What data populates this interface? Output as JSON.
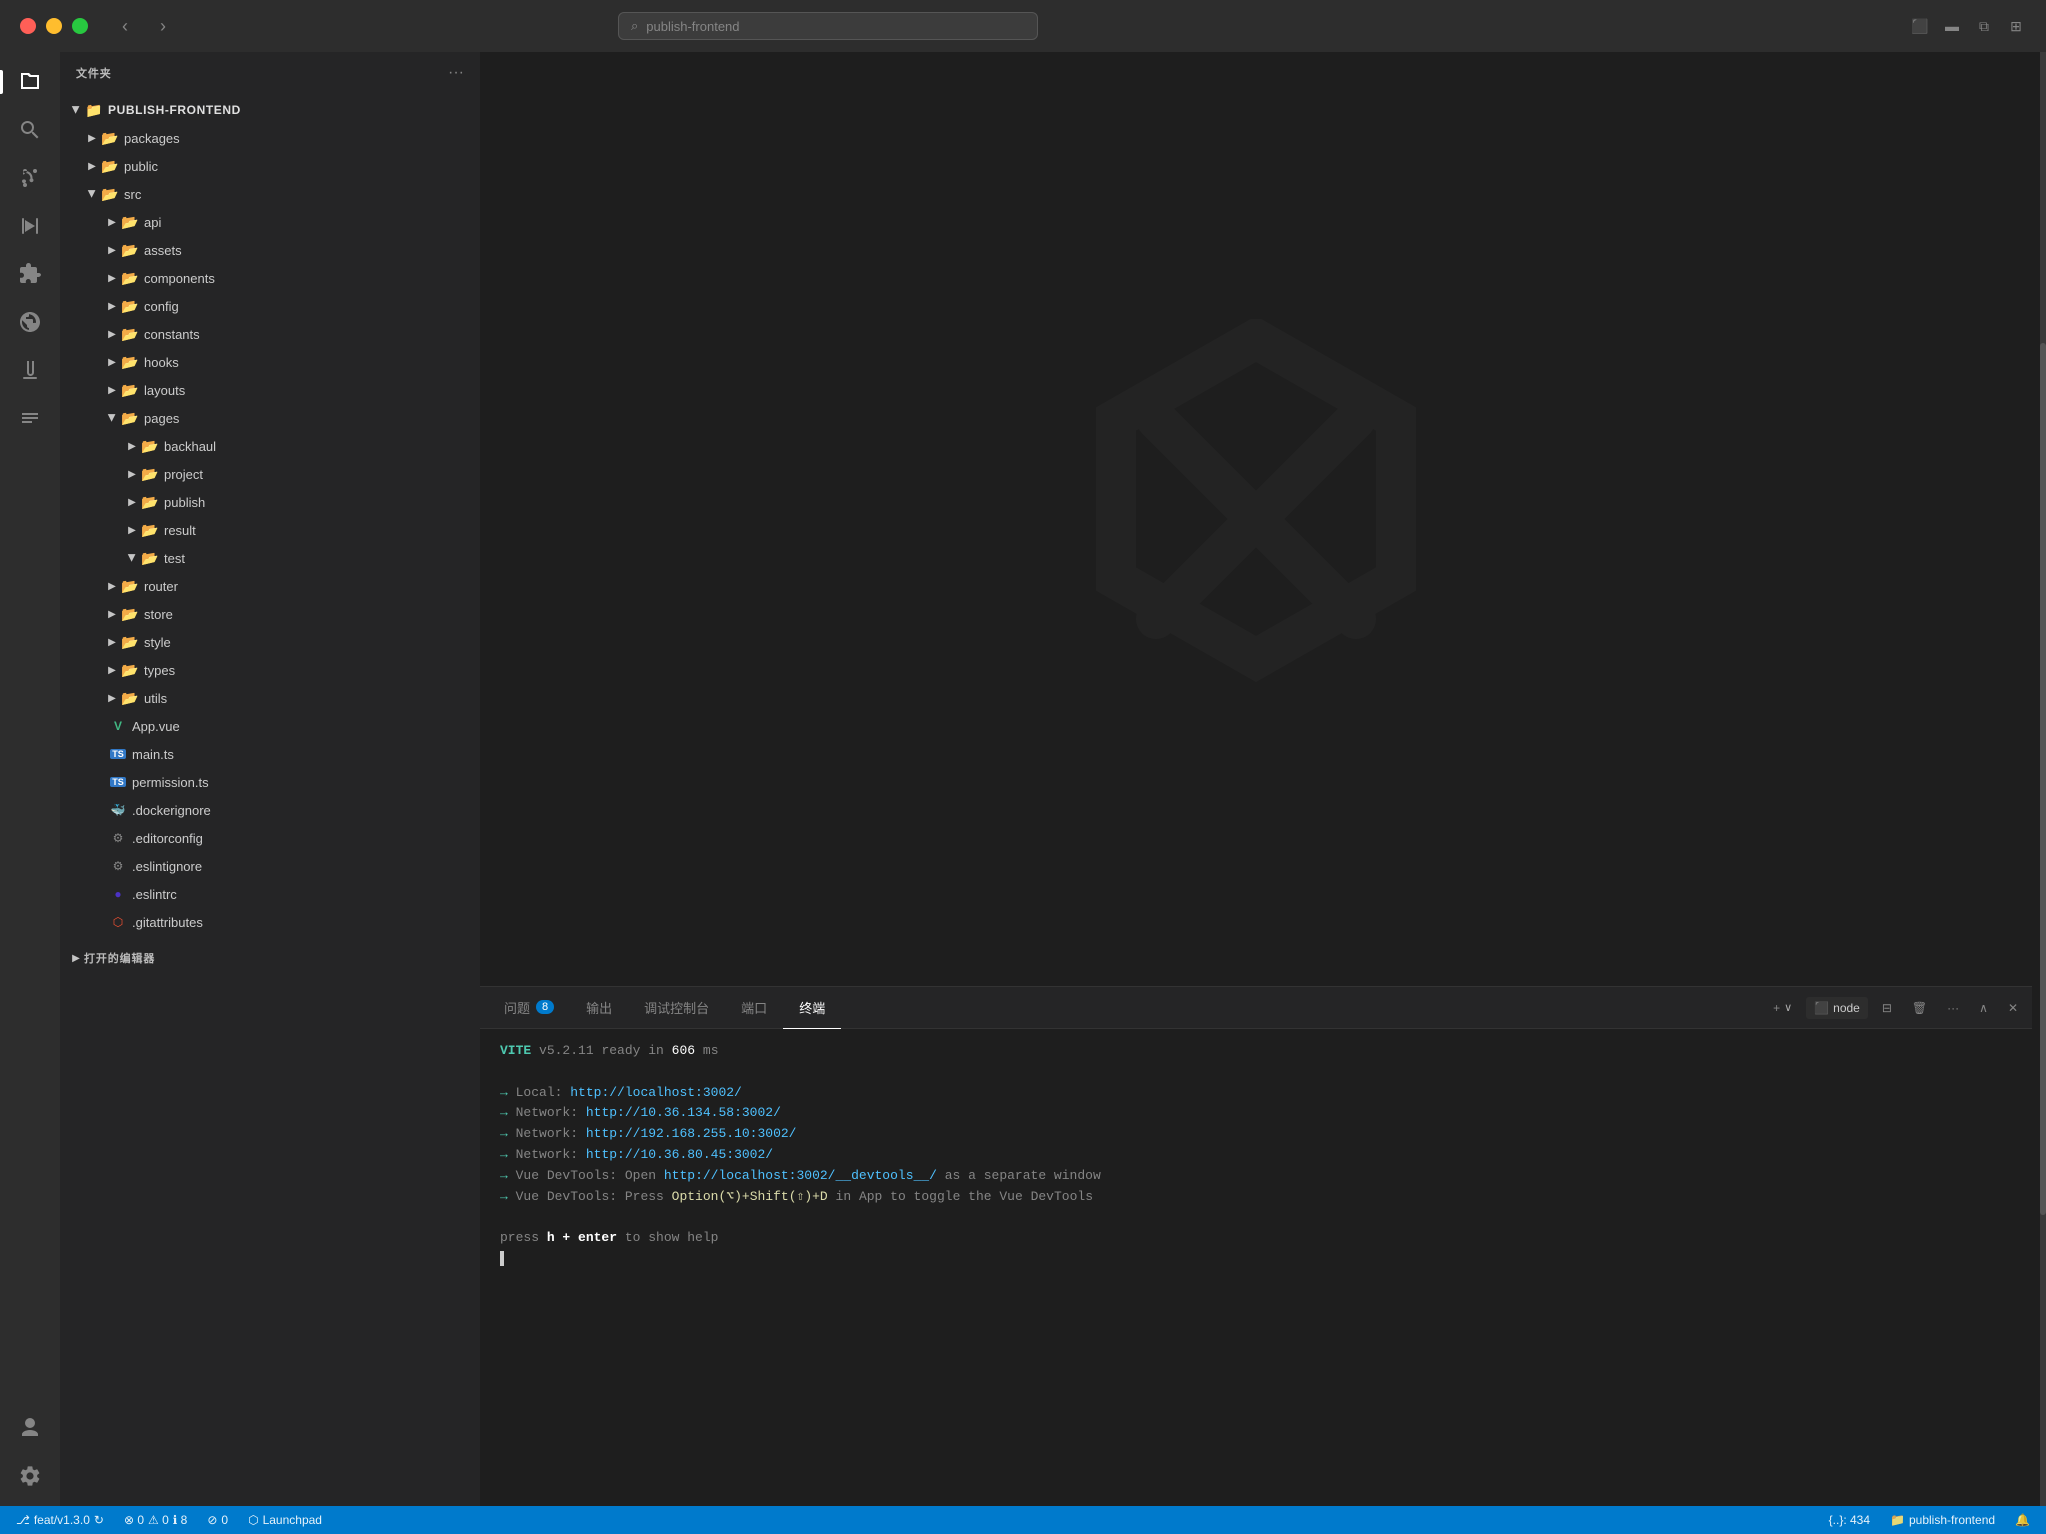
{
  "titlebar": {
    "search_placeholder": "publish-frontend",
    "nav_back": "‹",
    "nav_forward": "›"
  },
  "activity_bar": {
    "items": [
      {
        "id": "explorer",
        "icon": "files",
        "active": true
      },
      {
        "id": "search",
        "icon": "search"
      },
      {
        "id": "source-control",
        "icon": "source-control"
      },
      {
        "id": "run",
        "icon": "run"
      },
      {
        "id": "extensions",
        "icon": "extensions"
      },
      {
        "id": "remote",
        "icon": "remote"
      },
      {
        "id": "test",
        "icon": "test"
      },
      {
        "id": "checklist",
        "icon": "checklist"
      }
    ],
    "bottom_items": [
      {
        "id": "account",
        "icon": "account"
      },
      {
        "id": "settings",
        "icon": "settings"
      }
    ]
  },
  "sidebar": {
    "title": "文件夹",
    "root": {
      "name": "PUBLISH-FRONTEND",
      "expanded": true,
      "children": [
        {
          "name": "packages",
          "type": "folder",
          "expanded": false
        },
        {
          "name": "public",
          "type": "folder",
          "expanded": false
        },
        {
          "name": "src",
          "type": "folder",
          "expanded": true,
          "children": [
            {
              "name": "api",
              "type": "folder",
              "expanded": false
            },
            {
              "name": "assets",
              "type": "folder",
              "expanded": false
            },
            {
              "name": "components",
              "type": "folder",
              "expanded": false
            },
            {
              "name": "config",
              "type": "folder",
              "expanded": false
            },
            {
              "name": "constants",
              "type": "folder",
              "expanded": false
            },
            {
              "name": "hooks",
              "type": "folder",
              "expanded": false
            },
            {
              "name": "layouts",
              "type": "folder",
              "expanded": false
            },
            {
              "name": "pages",
              "type": "folder",
              "expanded": true,
              "children": [
                {
                  "name": "backhaul",
                  "type": "folder",
                  "expanded": false
                },
                {
                  "name": "project",
                  "type": "folder",
                  "expanded": false
                },
                {
                  "name": "publish",
                  "type": "folder",
                  "expanded": false
                },
                {
                  "name": "result",
                  "type": "folder",
                  "expanded": false
                },
                {
                  "name": "test",
                  "type": "folder",
                  "expanded": true,
                  "children": []
                }
              ]
            },
            {
              "name": "router",
              "type": "folder",
              "expanded": false
            },
            {
              "name": "store",
              "type": "folder",
              "expanded": false
            },
            {
              "name": "style",
              "type": "folder",
              "expanded": false
            },
            {
              "name": "types",
              "type": "folder",
              "expanded": false
            },
            {
              "name": "utils",
              "type": "folder",
              "expanded": false
            }
          ]
        },
        {
          "name": "App.vue",
          "type": "vue"
        },
        {
          "name": "main.ts",
          "type": "ts"
        },
        {
          "name": "permission.ts",
          "type": "ts"
        },
        {
          "name": ".dockerignore",
          "type": "docker"
        },
        {
          "name": ".editorconfig",
          "type": "config"
        },
        {
          "name": ".eslintignore",
          "type": "config"
        },
        {
          "name": ".eslintrc",
          "type": "config"
        },
        {
          "name": ".gitattributes",
          "type": "git"
        }
      ]
    },
    "open_editors_label": "打开的编辑器"
  },
  "terminal": {
    "tabs": [
      {
        "id": "problems",
        "label": "问题",
        "badge": "8"
      },
      {
        "id": "output",
        "label": "输出"
      },
      {
        "id": "debug-console",
        "label": "调试控制台"
      },
      {
        "id": "ports",
        "label": "端口"
      },
      {
        "id": "terminal",
        "label": "终端",
        "active": true
      }
    ],
    "toolbar": {
      "new_terminal": "+",
      "terminal_name": "node",
      "split": "⊟",
      "trash": "🗑",
      "more": "···",
      "chevron_up": "∧",
      "close": "✕"
    },
    "content": [
      {
        "type": "vite-ready",
        "text": "VITE v5.2.11  ready in 606 ms"
      },
      {
        "type": "blank"
      },
      {
        "type": "network",
        "label": "Local:",
        "url": "http://localhost:3002/"
      },
      {
        "type": "network",
        "label": "Network:",
        "url": "http://10.36.134.58:3002/"
      },
      {
        "type": "network",
        "label": "Network:",
        "url": "http://192.168.255.10:3002/"
      },
      {
        "type": "network",
        "label": "Network:",
        "url": "http://10.36.80.45:3002/"
      },
      {
        "type": "devtools",
        "text1": "Vue DevTools: ",
        "text2": "Open http://localhost:3002/__devtools__/ as a separate window"
      },
      {
        "type": "devtools2",
        "text1": "Vue DevTools: ",
        "text2": "Press Option(⌥)+Shift(⇧)+D in App to toggle the Vue DevTools"
      },
      {
        "type": "blank"
      },
      {
        "type": "help",
        "prefix": "press ",
        "key": "h + enter",
        "suffix": " to show help"
      },
      {
        "type": "cursor"
      }
    ]
  },
  "status_bar": {
    "branch": "feat/v1.3.0",
    "sync": "⟳",
    "errors": "⊗ 0",
    "warnings": "⚠ 0",
    "info": "ℹ 8",
    "no_problems": "⊘ 0",
    "cursor_pos": "{..}: 434",
    "project": "publish-frontend",
    "launchpad": "Launchpad",
    "bell": "🔔",
    "remote": "⊗ 0 ⚠ 0 ℹ 8"
  }
}
